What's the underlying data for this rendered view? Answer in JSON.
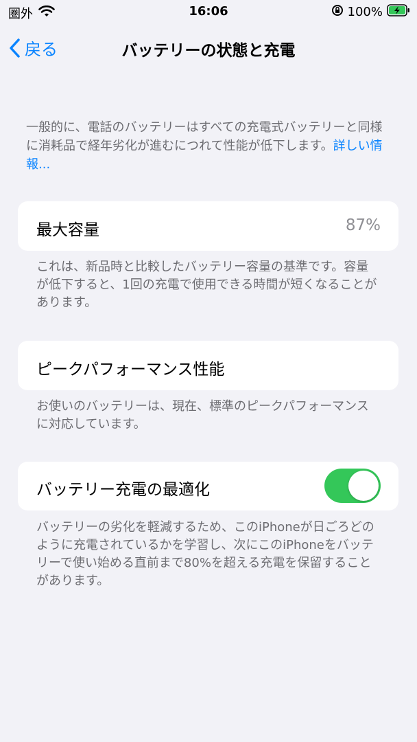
{
  "status_bar": {
    "carrier": "圏外",
    "time": "16:06",
    "battery_percent": "100%"
  },
  "nav": {
    "back_label": "戻る",
    "title": "バッテリーの状態と充電"
  },
  "intro": {
    "text": "一般的に、電話のバッテリーはすべての充電式バッテリーと同様に消耗品で経年劣化が進むにつれて性能が低下します。",
    "link": "詳しい情報..."
  },
  "max_capacity": {
    "label": "最大容量",
    "value": "87%",
    "footnote": "これは、新品時と比較したバッテリー容量の基準です。容量が低下すると、1回の充電で使用できる時間が短くなることがあります。"
  },
  "peak_performance": {
    "label": "ピークパフォーマンス性能",
    "footnote": "お使いのバッテリーは、現在、標準のピークパフォーマンスに対応しています。"
  },
  "optimized_charging": {
    "label": "バッテリー充電の最適化",
    "enabled": true,
    "footnote": "バッテリーの劣化を軽減するため、このiPhoneが日ごろどのように充電されているかを学習し、次にこのiPhoneをバッテリーで使い始める直前まで80%を超える充電を保留することがあります。"
  },
  "colors": {
    "accent": "#0a84ff",
    "toggle_on": "#34c759",
    "background": "#f2f2f7"
  }
}
